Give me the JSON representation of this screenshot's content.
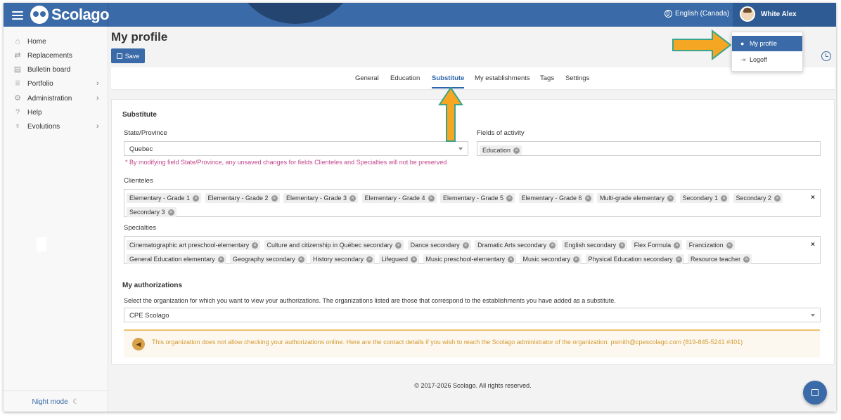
{
  "app": {
    "logo_text": "Scolago",
    "language": "English (Canada)",
    "user_name": "White Alex"
  },
  "sidebar": {
    "items": [
      {
        "label": "Home",
        "icon": "home-icon",
        "has_children": false
      },
      {
        "label": "Replacements",
        "icon": "replacements-icon",
        "has_children": false
      },
      {
        "label": "Bulletin board",
        "icon": "bulletin-board-icon",
        "has_children": false
      },
      {
        "label": "Portfolio",
        "icon": "trophy-icon",
        "has_children": true
      },
      {
        "label": "Administration",
        "icon": "gear-icon",
        "has_children": true
      },
      {
        "label": "Help",
        "icon": "question-icon",
        "has_children": false
      },
      {
        "label": "Evolutions",
        "icon": "sprout-icon",
        "has_children": true
      }
    ],
    "night_mode": "Night mode"
  },
  "page": {
    "title": "My profile",
    "save_label": "Save"
  },
  "tabs": [
    "General",
    "Education",
    "Substitute",
    "My establishments",
    "Tags",
    "Settings"
  ],
  "active_tab": "Substitute",
  "substitute": {
    "title": "Substitute",
    "state_label": "State/Province",
    "state_value": "Quebec",
    "state_warning": "* By modifying field State/Province, any unsaved changes for fields Clienteles and Specialties will not be preserved",
    "fields_label": "Fields of activity",
    "fields": [
      "Education"
    ],
    "clienteles_label": "Clienteles",
    "clienteles": [
      "Elementary - Grade 1",
      "Elementary - Grade 2",
      "Elementary - Grade 3",
      "Elementary - Grade 4",
      "Elementary - Grade 5",
      "Elementary - Grade 6",
      "Multi-grade elementary",
      "Secondary 1",
      "Secondary 2",
      "Secondary 3"
    ],
    "specialties_label": "Specialties",
    "specialties": [
      "Cinematographic art preschool-elementary",
      "Culture and citizenship in Québec secondary",
      "Dance secondary",
      "Dramatic Arts secondary",
      "English secondary",
      "Flex Formula",
      "Francization",
      "General Education elementary",
      "Geography secondary",
      "History secondary",
      "Lifeguard",
      "Music preschool-elementary",
      "Music secondary",
      "Physical Education secondary",
      "Resource teacher"
    ]
  },
  "authorizations": {
    "title": "My authorizations",
    "help": "Select the organization for which you want to view your authorizations. The organizations listed are those that correspond to the establishments you have added as a substitute.",
    "organization": "CPE Scolago",
    "alert": "This organization does not allow checking your authorizations online. Here are the contact details if you wish to reach the Scolago administrator of the organization: psmith@cpescolago.com (819-845-5241 #401)"
  },
  "footer": "© 2017-2026 Scolago. All rights reserved.",
  "user_menu": [
    {
      "label": "My profile",
      "icon": "person-icon",
      "active": true
    },
    {
      "label": "Logoff",
      "icon": "logout-icon",
      "active": false
    }
  ],
  "colors": {
    "brand": "#3a6aa8",
    "annotation_arrow": "#f5a623",
    "annotation_outline": "#3aa58c",
    "warning_text": "#c2458b",
    "alert_text": "#d29a32"
  }
}
